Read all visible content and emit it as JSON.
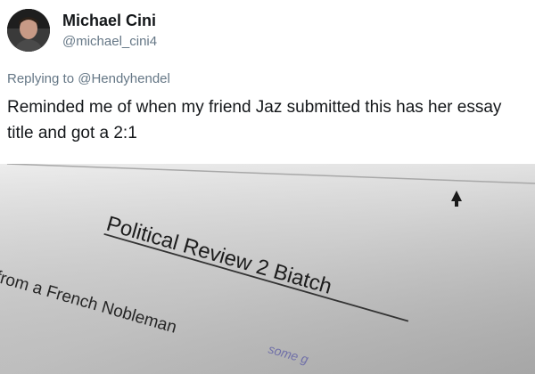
{
  "author": {
    "display_name": "Michael Cini",
    "handle": "@michael_cini4",
    "avatar_icon": "profile-photo"
  },
  "reply": {
    "prefix": "Replying to",
    "to_handle": "@Hendyhendel"
  },
  "tweet": {
    "text": "Reminded me of when my friend Jaz submitted this has her essay title and got a 2:1"
  },
  "media": {
    "title_text": "Political Review 2 Biatch",
    "subtitle_text": "from a French Nobleman",
    "corner_text": "some g",
    "cursor_icon": "mouse-cursor-icon"
  },
  "colors": {
    "name": "#14171a",
    "secondary": "#657786",
    "photo_bg": "#dcdcdc"
  }
}
